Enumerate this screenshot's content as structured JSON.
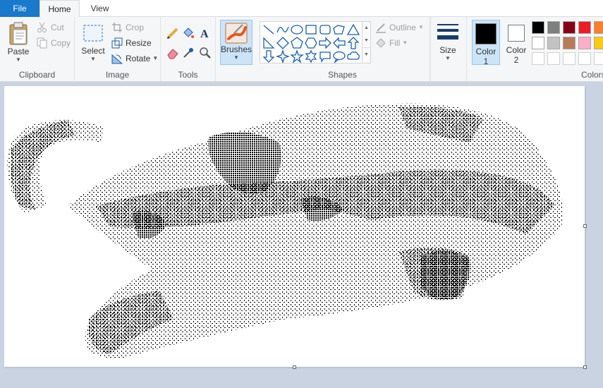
{
  "tabs": {
    "file": "File",
    "home": "Home",
    "view": "View"
  },
  "clipboard": {
    "paste": "Paste",
    "cut": "Cut",
    "copy": "Copy",
    "label": "Clipboard"
  },
  "image": {
    "select": "Select",
    "crop": "Crop",
    "resize": "Resize",
    "rotate": "Rotate",
    "label": "Image"
  },
  "tools": {
    "label": "Tools"
  },
  "brushes": {
    "label": "Brushes"
  },
  "shapes": {
    "outline": "Outline",
    "fill": "Fill",
    "label": "Shapes"
  },
  "size": {
    "label": "Size"
  },
  "color1": {
    "label": "Color",
    "num": "1",
    "value": "#000000"
  },
  "color2": {
    "label": "Color",
    "num": "2",
    "value": "#ffffff"
  },
  "colors": {
    "label": "Colors",
    "palette": [
      [
        "#000000",
        "#7f7f7f",
        "#880015",
        "#ed1c24",
        "#ff7f27"
      ],
      [
        "#ffffff",
        "#c3c3c3",
        "#b97a57",
        "#ffaec9",
        "#ffc90e"
      ],
      [
        "#ffffff",
        "#ffffff",
        "#ffffff",
        "#ffffff",
        "#ffffff"
      ]
    ]
  },
  "accent": "#1979ca",
  "canvas_background": "#ffffff",
  "workspace_background": "#c9d3e2"
}
